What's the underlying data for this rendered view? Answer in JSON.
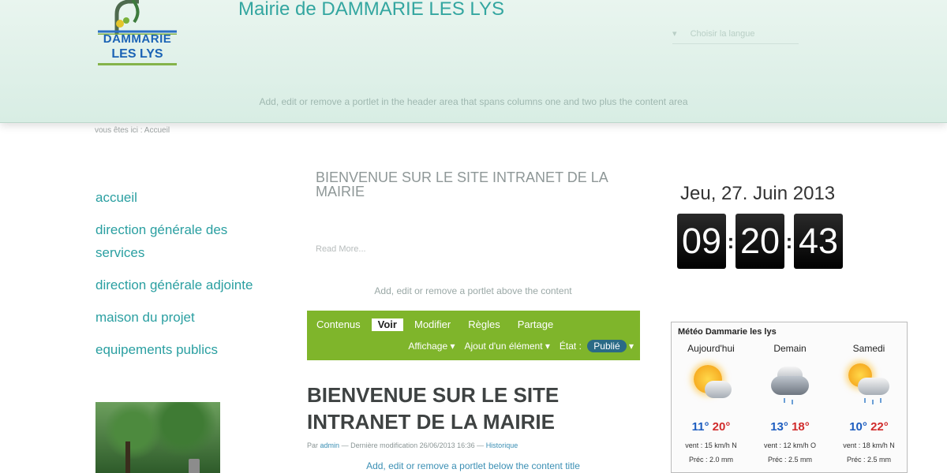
{
  "header": {
    "logo_line1": "DAMMARIE",
    "logo_line2": "LES LYS",
    "site_title": "Mairie de DAMMARIE LES LYS",
    "language_select": "Choisir la langue",
    "portlet_text": "Add, edit or remove a portlet in the header area that spans columns one and two plus the content area"
  },
  "breadcrumb": "vous êtes ici : Accueil",
  "nav": {
    "items": [
      {
        "label": "accueil"
      },
      {
        "label": "direction générale des services"
      },
      {
        "label": "direction générale adjointe"
      },
      {
        "label": "maison du projet"
      },
      {
        "label": "equipements publics"
      }
    ]
  },
  "main": {
    "welcome_heading": "BIENVENUE SUR LE SITE INTRANET DE LA MAIRIE",
    "read_more": "Read More...",
    "portlet_above": "Add, edit or remove a portlet above the content",
    "toolbar": {
      "tabs": [
        {
          "label": "Contenus",
          "active": false
        },
        {
          "label": "Voir",
          "active": true
        },
        {
          "label": "Modifier",
          "active": false
        },
        {
          "label": "Règles",
          "active": false
        },
        {
          "label": "Partage",
          "active": false
        }
      ],
      "display_menu": "Affichage ▾",
      "add_item_menu": "Ajout d'un élément ▾",
      "state_label": "État :",
      "state_value": "Publié",
      "state_arrow": "▾"
    },
    "doc_title": "BIENVENUE SUR LE SITE INTRANET DE LA MAIRIE",
    "byline_prefix": "Par",
    "byline_author": "admin",
    "byline_modified": "— Dernière modification 26/06/2013 16:36 —",
    "byline_history": "Historique",
    "portlet_below": "Add, edit or remove a portlet below the content title"
  },
  "clock": {
    "date": "Jeu, 27. Juin 2013",
    "hours": "09",
    "minutes": "20",
    "seconds": "43",
    "separator": ":"
  },
  "weather": {
    "title": "Météo Dammarie les lys",
    "days": [
      {
        "name": "Aujourd'hui",
        "icon": "sun-cloud-icon",
        "min": "11°",
        "max": "20°",
        "wind": "vent : 15 km/h N",
        "rain": "Préc : 2.0 mm"
      },
      {
        "name": "Demain",
        "icon": "cloud-rain-icon",
        "min": "13°",
        "max": "18°",
        "wind": "vent : 12 km/h O",
        "rain": "Préc : 2.5 mm"
      },
      {
        "name": "Samedi",
        "icon": "sun-cloud-rain-icon",
        "min": "10°",
        "max": "22°",
        "wind": "vent : 18 km/h N",
        "rain": "Préc : 2.5 mm"
      }
    ]
  },
  "colors": {
    "header_bg": "#dcefe6",
    "title_teal": "#33a6a0",
    "nav_link": "#2a9fa1",
    "toolbar_green": "#7fb52b",
    "state_pill": "#2a6a86",
    "temp_min": "#1e5ec0",
    "temp_max": "#d12c2c"
  }
}
